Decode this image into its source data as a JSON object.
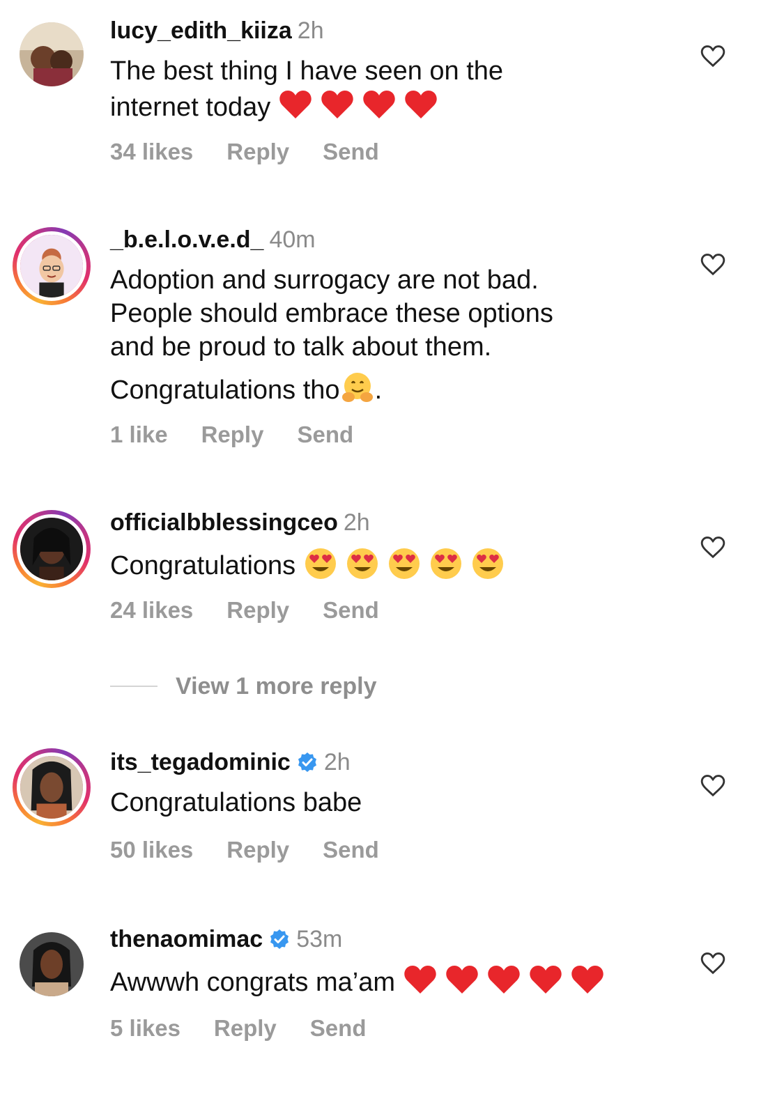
{
  "comments": [
    {
      "username": "lucy_edith_kiiza",
      "time": "2h",
      "verified": false,
      "text_line1": "The best thing I have seen on the",
      "text_line2": "internet today",
      "emojis": [
        "red-heart",
        "red-heart",
        "red-heart",
        "red-heart"
      ],
      "likes": "34 likes",
      "reply": "Reply",
      "send": "Send",
      "avatar_icon": "avatar-photo"
    },
    {
      "username": "_b.e.l.o.v.e.d_",
      "time": "40m",
      "verified": false,
      "text_line1": "Adoption and surrogacy are not bad.",
      "text_line2": "People should embrace these options",
      "text_line3": "and be proud to talk about them.",
      "text_line4": "Congratulations tho",
      "text_line4_end": ".",
      "emojis": [
        "hugging-face"
      ],
      "likes": "1 like",
      "reply": "Reply",
      "send": "Send",
      "avatar_icon": "avatar-memoji",
      "story_ring": true
    },
    {
      "username": "officialbblessingceo",
      "time": "2h",
      "verified": false,
      "text_line1": "Congratulations",
      "emojis": [
        "heart-eyes",
        "heart-eyes",
        "heart-eyes",
        "heart-eyes",
        "heart-eyes"
      ],
      "likes": "24 likes",
      "reply": "Reply",
      "send": "Send",
      "avatar_icon": "avatar-photo",
      "story_ring": true
    },
    {
      "username": "its_tegadominic",
      "time": "2h",
      "verified": true,
      "text_line1": "Congratulations babe",
      "likes": "50 likes",
      "reply": "Reply",
      "send": "Send",
      "avatar_icon": "avatar-photo",
      "story_ring": true
    },
    {
      "username": "thenaomimac",
      "time": "53m",
      "verified": true,
      "text_line1": "Awwwh congrats ma’am",
      "emojis": [
        "red-heart",
        "red-heart",
        "red-heart",
        "red-heart",
        "red-heart"
      ],
      "likes": "5 likes",
      "reply": "Reply",
      "send": "Send",
      "avatar_icon": "avatar-photo"
    }
  ],
  "view_more_replies": "View 1 more reply",
  "colors": {
    "text": "#111111",
    "muted": "#8e8e8e",
    "verified": "#3897f0",
    "heart": "#e8262b"
  },
  "icons": {
    "like": "heart-outline-icon",
    "verified": "verified-badge-icon"
  }
}
